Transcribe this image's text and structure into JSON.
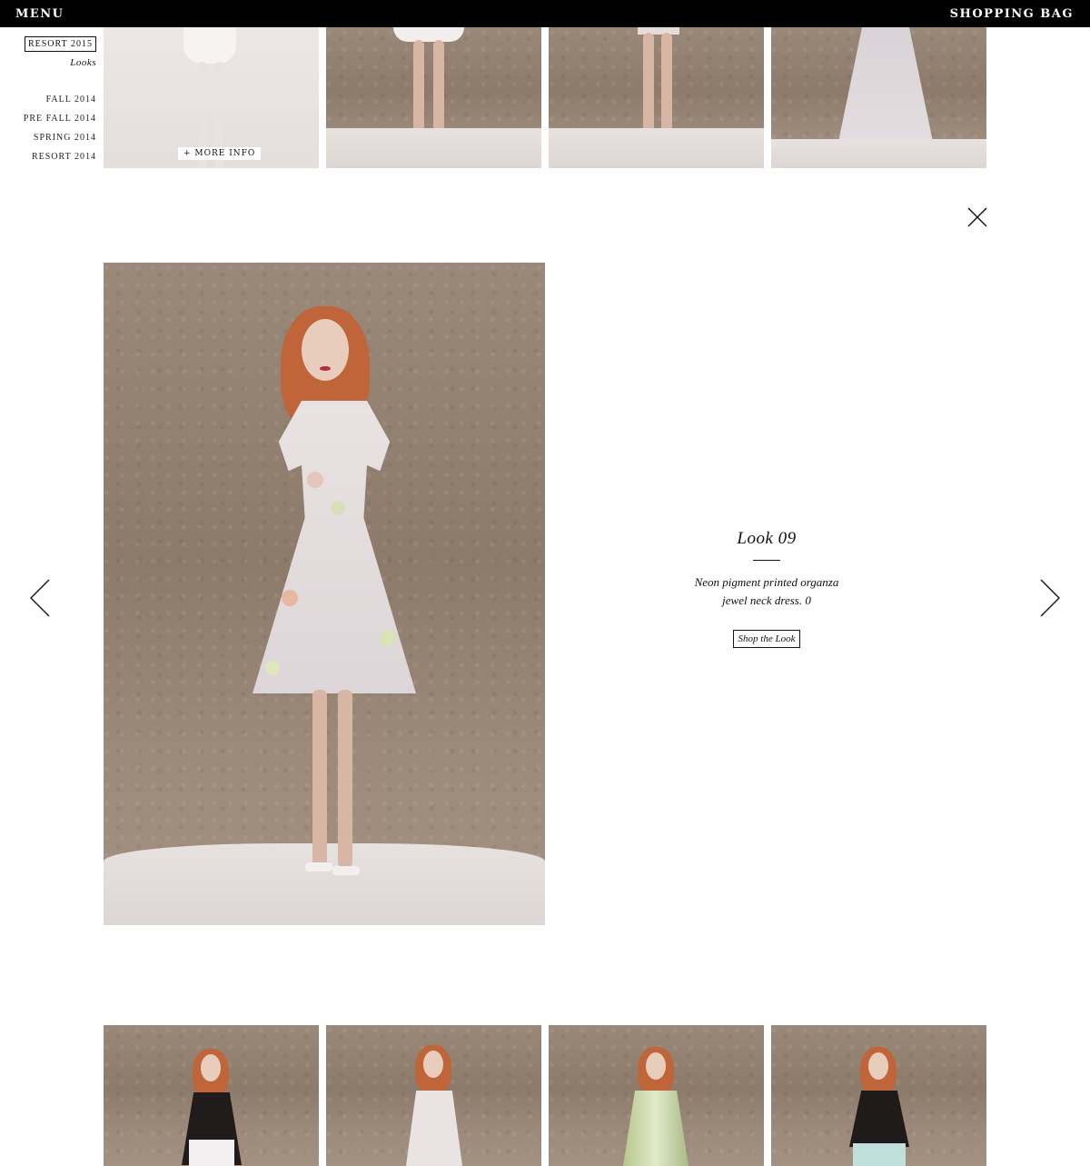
{
  "topbar": {
    "menu_label": "MENU",
    "bag_label": "SHOPPING BAG"
  },
  "leftnav": {
    "current_collection": "RESORT 2015",
    "current_sub": "Looks",
    "seasons": [
      "FALL 2014",
      "PRE FALL 2014",
      "SPRING 2014",
      "RESORT 2014"
    ]
  },
  "top_strip": {
    "more_info_label": "+ MORE INFO"
  },
  "look": {
    "title": "Look 09",
    "description_line1": "Neon pigment printed organza",
    "description_line2": "jewel neck dress. 0",
    "shop_label": "Shop the Look"
  },
  "colors": {
    "topbar": "#000000",
    "background": "#ffffff",
    "wall": "#8f7d6d"
  }
}
